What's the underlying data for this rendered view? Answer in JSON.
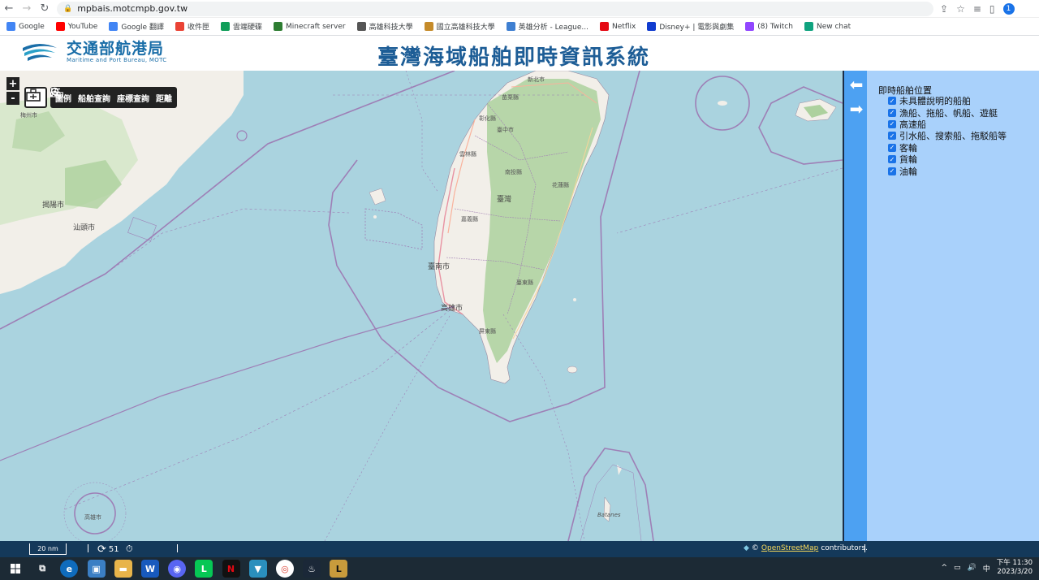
{
  "browser": {
    "url": "mpbais.motcmpb.gov.tw",
    "bookmarks": [
      {
        "label": "Google",
        "icon": "google-icon",
        "color": "#4285f4"
      },
      {
        "label": "YouTube",
        "icon": "youtube-icon",
        "color": "#ff0000"
      },
      {
        "label": "Google 翻譯",
        "icon": "translate-icon",
        "color": "#4285f4"
      },
      {
        "label": "收件匣",
        "icon": "gmail-icon",
        "color": "#ea4335"
      },
      {
        "label": "雲端硬碟",
        "icon": "drive-icon",
        "color": "#0f9d58"
      },
      {
        "label": "Minecraft server",
        "icon": "minecraft-icon",
        "color": "#2e7d32"
      },
      {
        "label": "高雄科技大學",
        "icon": "globe-icon",
        "color": "#555555"
      },
      {
        "label": "國立高雄科技大學",
        "icon": "university-icon",
        "color": "#c58b2a"
      },
      {
        "label": "英雄分析 - League...",
        "icon": "analytics-icon",
        "color": "#3f7fd1"
      },
      {
        "label": "Netflix",
        "icon": "netflix-icon",
        "color": "#e50914"
      },
      {
        "label": "Disney+ | 電影與劇集",
        "icon": "disney-icon",
        "color": "#113ccf"
      },
      {
        "label": "(8) Twitch",
        "icon": "twitch-icon",
        "color": "#9146ff"
      },
      {
        "label": "New chat",
        "icon": "chat-icon",
        "color": "#10a37f"
      }
    ],
    "profile_initial": "1"
  },
  "header": {
    "logo_cn": "交通部航港局",
    "logo_en": "Maritime and Port Bureau, MOTC",
    "title": "臺灣海域船舶即時資訊系統"
  },
  "map": {
    "zoom_in": "+",
    "zoom_out": "-",
    "toolbar": {
      "legend": "圖例",
      "ship_search": "船舶查詢",
      "coord_search": "座標查詢",
      "distance": "距離"
    },
    "labels": {
      "taiwan": "臺灣",
      "tainan": "臺南市",
      "kaohsiung": "高雄市",
      "jieyang": "揭陽市",
      "shantou": "汕頭市",
      "meizhou": "梅州市",
      "pingtung": "屏東縣",
      "taitung": "臺東縣",
      "hualien": "花蓮縣",
      "batanes": "Batanes",
      "taichung": "臺中市",
      "nantou": "南投縣",
      "yunlin": "雲林縣",
      "chiayi": "嘉義縣",
      "pratas": "高雄市",
      "xinbei": "新北市",
      "miaoli": "苗栗縣",
      "changhua": "彰化縣"
    }
  },
  "panel": {
    "title": "即時船舶位置",
    "items": [
      {
        "label": "未具體說明的船舶",
        "checked": true
      },
      {
        "label": "漁船、拖船、帆船、遊艇",
        "checked": true
      },
      {
        "label": "高速船",
        "checked": true
      },
      {
        "label": "引水船、搜索船、拖駁船等",
        "checked": true
      },
      {
        "label": "客輪",
        "checked": true
      },
      {
        "label": "貨輪",
        "checked": true
      },
      {
        "label": "油輪",
        "checked": true
      }
    ]
  },
  "footer": {
    "scale": "20 nm",
    "refresh_count": "51",
    "attribution_link": "OpenStreetMap",
    "attribution_rest": "contributors.",
    "copyright": "©"
  },
  "taskbar": {
    "time": "下午 11:30",
    "date": "2023/3/20",
    "ime": "中"
  },
  "colors": {
    "sea": "#aad3df",
    "land": "#f2efe9",
    "forest": "#add19e",
    "panel": "#a9d1fb",
    "panel_strip": "#4da1f2",
    "footer": "#14395a",
    "title": "#1d5d96"
  }
}
